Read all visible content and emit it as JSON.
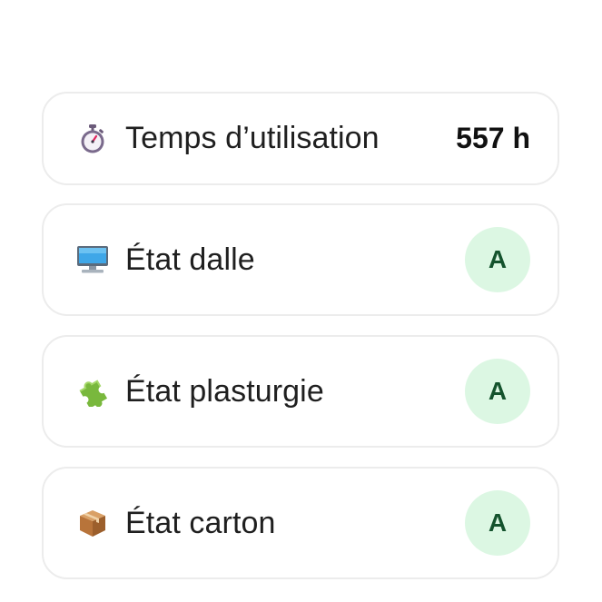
{
  "items": [
    {
      "icon": "stopwatch-icon",
      "label": "Temps d’utilisation",
      "value": "557 h"
    },
    {
      "icon": "desktop-computer-icon",
      "label": "État dalle",
      "grade": "A"
    },
    {
      "icon": "puzzle-piece-icon",
      "label": "État plasturgie",
      "grade": "A"
    },
    {
      "icon": "package-box-icon",
      "label": "État carton",
      "grade": "A"
    }
  ],
  "colors": {
    "grade_background": "#dcf7e3",
    "grade_text": "#14532d",
    "card_border": "#ececec"
  }
}
